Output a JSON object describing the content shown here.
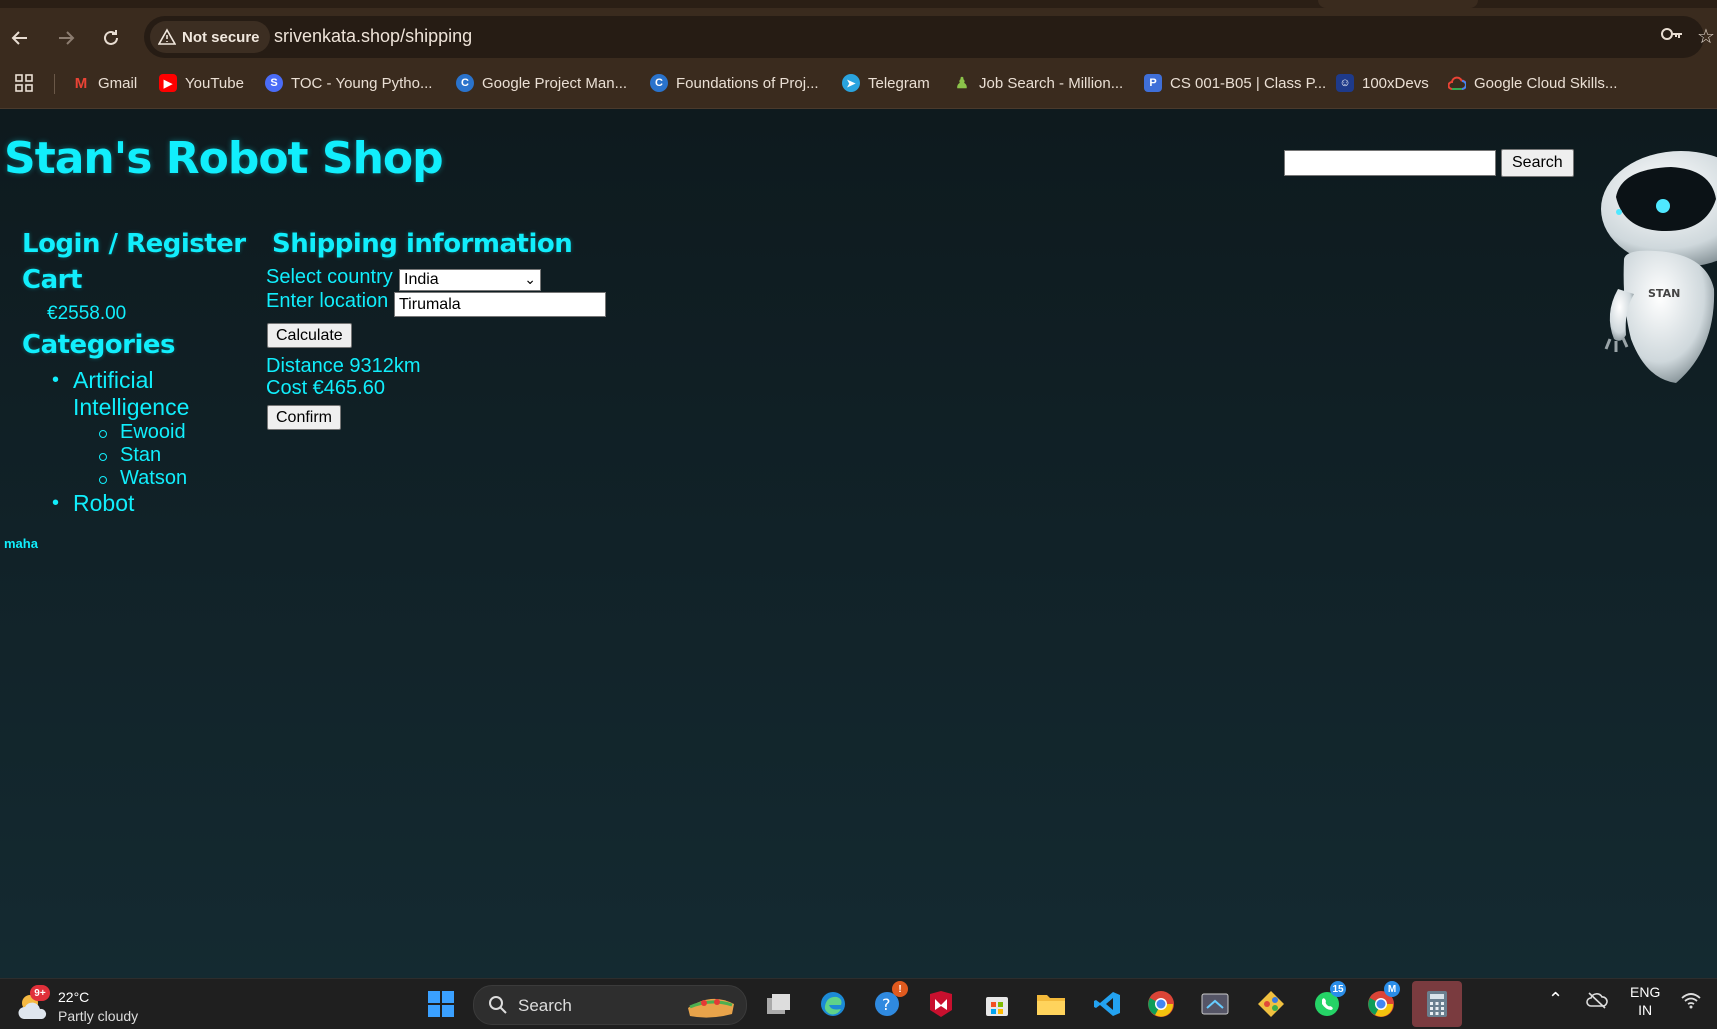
{
  "browser": {
    "security_label": "Not secure",
    "url": "srivenkata.shop/shipping",
    "bookmarks": [
      {
        "label": "Gmail",
        "icon": "gmail-icon",
        "color": "#ea4335"
      },
      {
        "label": "YouTube",
        "icon": "youtube-icon",
        "color": "#ff0000"
      },
      {
        "label": "TOC - Young Pytho...",
        "icon": "toc-icon",
        "color": "#4a6cf7"
      },
      {
        "label": "Google Project Man...",
        "icon": "coursera-icon",
        "color": "#2a73cc"
      },
      {
        "label": "Foundations of Proj...",
        "icon": "coursera-icon",
        "color": "#2a73cc"
      },
      {
        "label": "Telegram",
        "icon": "telegram-icon",
        "color": "#2aa3de"
      },
      {
        "label": "Job Search - Million...",
        "icon": "job-search-icon",
        "color": "#8bc34a"
      },
      {
        "label": "CS 001-B05 | Class P...",
        "icon": "classpage-icon",
        "color": "#3f6fd8"
      },
      {
        "label": "100xDevs",
        "icon": "devs-icon",
        "color": "#1e3a8a"
      },
      {
        "label": "Google Cloud Skills...",
        "icon": "google-cloud-icon",
        "color": "#fbbc05"
      }
    ]
  },
  "site": {
    "title": "Stan's Robot Shop",
    "search_button": "Search",
    "sidebar": {
      "login_heading": "Login / Register",
      "cart_heading": "Cart",
      "cart_total": "€2558.00",
      "categories_heading": "Categories",
      "categories": [
        {
          "label": "Artificial Intelligence",
          "children": [
            "Ewooid",
            "Stan",
            "Watson"
          ]
        },
        {
          "label": "Robot",
          "children": []
        }
      ]
    },
    "footer_note": "maha",
    "shipping": {
      "heading": "Shipping information",
      "country_label": "Select country",
      "country_value": "India",
      "location_label": "Enter location",
      "location_value": "Tirumala",
      "calculate_button": "Calculate",
      "distance_text": "Distance 9312km",
      "cost_text": "Cost €465.60",
      "confirm_button": "Confirm"
    },
    "robot_mascot_label": "STAN",
    "accent_color": "#11eefc"
  },
  "taskbar": {
    "weather_temp": "22°C",
    "weather_condition": "Partly cloudy",
    "weather_badge": "9+",
    "search_label": "Search",
    "language": "ENG",
    "region": "IN",
    "whatsapp_badge": "15",
    "chrome_badge": "M"
  }
}
